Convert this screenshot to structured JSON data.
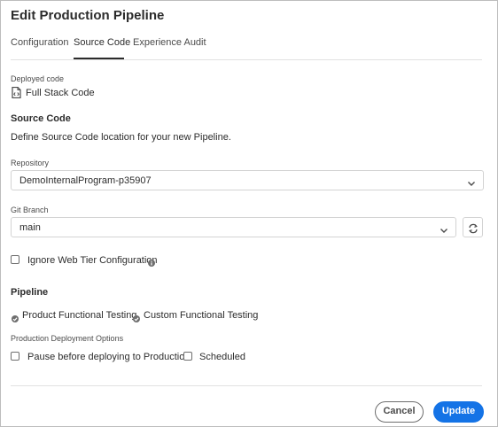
{
  "dialog": {
    "title": "Edit Production Pipeline",
    "tabs": [
      {
        "label": "Configuration"
      },
      {
        "label": "Source Code"
      },
      {
        "label": "Experience Audit"
      }
    ]
  },
  "deployed": {
    "label": "Deployed code",
    "value": "Full Stack Code",
    "icon": "file-code-icon"
  },
  "source_code": {
    "heading": "Source Code",
    "description": "Define Source Code location for your new Pipeline.",
    "repository_label": "Repository",
    "repository_value": "DemoInternalProgram-p35907",
    "branch_label": "Git Branch",
    "branch_value": "main",
    "ignore_web_tier_label": "Ignore Web Tier Configuration"
  },
  "pipeline": {
    "heading": "Pipeline",
    "tests": [
      {
        "label": "Product Functional Testing"
      },
      {
        "label": "Custom Functional Testing"
      }
    ],
    "options_label": "Production Deployment Options",
    "pause_label": "Pause before deploying to Production",
    "scheduled_label": "Scheduled"
  },
  "actions": {
    "cancel": "Cancel",
    "update": "Update"
  },
  "colors": {
    "accent": "#1473e6",
    "text": "#2c2c2c",
    "border": "#d3d3d3"
  }
}
